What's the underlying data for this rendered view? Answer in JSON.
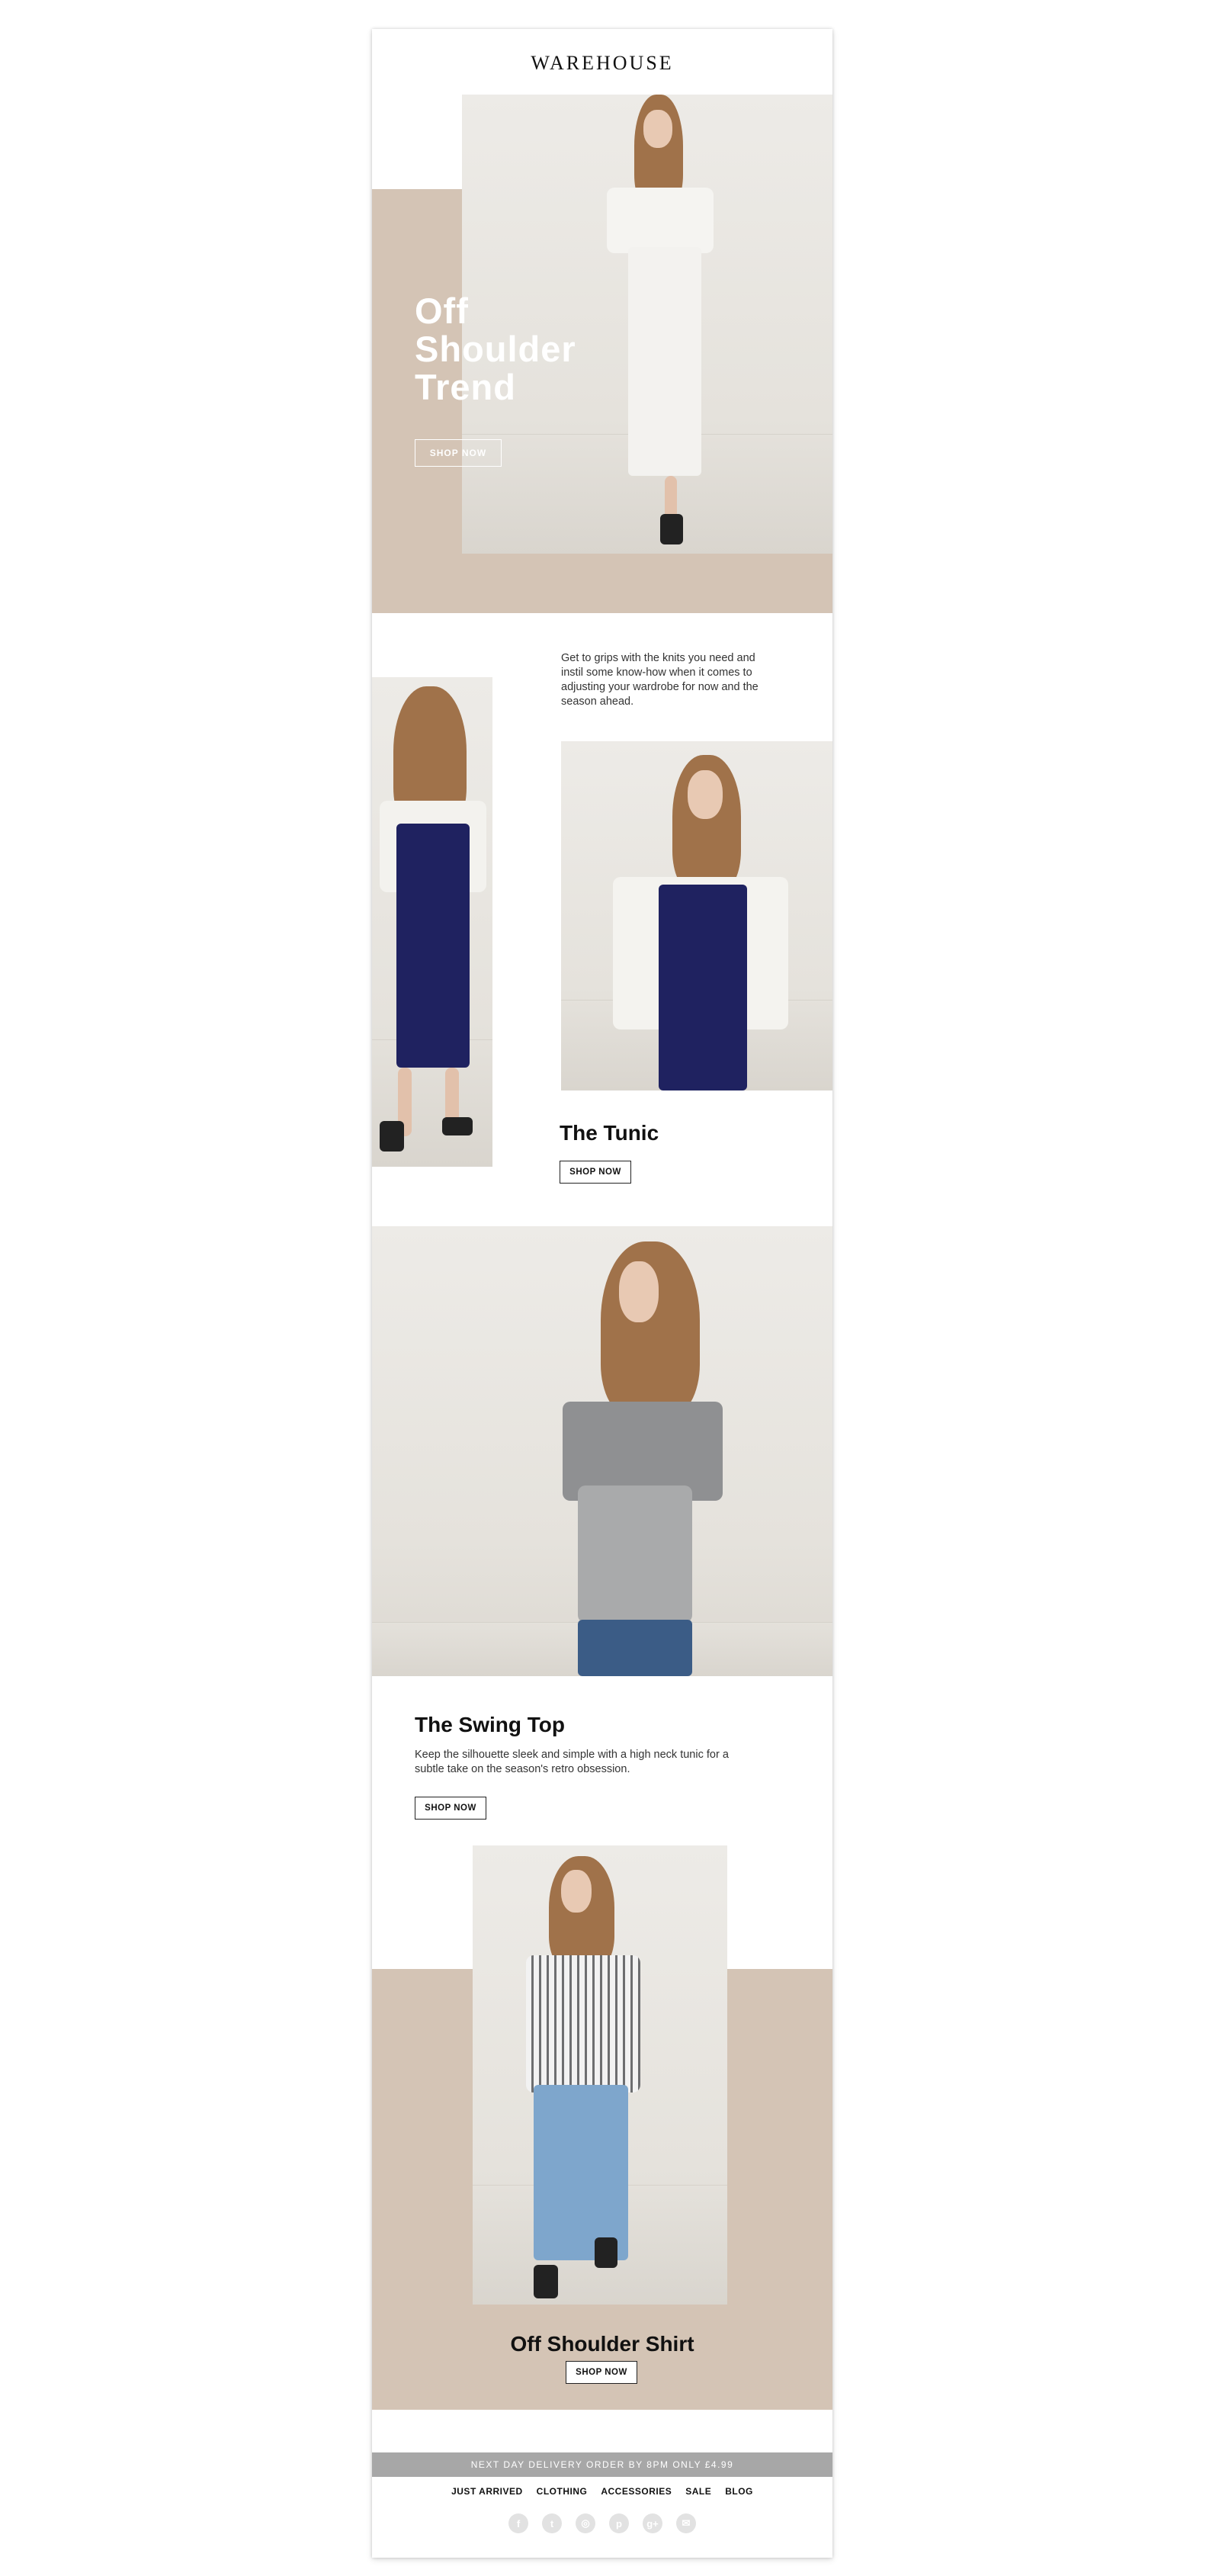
{
  "brand": {
    "logo": "WAREHOUSE"
  },
  "hero": {
    "title_lines": [
      "Off",
      "Shoulder",
      "Trend"
    ],
    "cta": "SHOP NOW",
    "accent_color": "#d4c4b5"
  },
  "tunic": {
    "intro": "Get to grips with the knits you need and instil some know-how when it comes to adjusting your wardrobe for now and the season ahead.",
    "title": "The Tunic",
    "cta": "SHOP NOW"
  },
  "swing_top": {
    "title": "The Swing Top",
    "description": "Keep the silhouette sleek and simple with a high neck tunic for a subtle take on the season's retro obsession.",
    "cta": "SHOP NOW"
  },
  "shirt": {
    "title": "Off Shoulder Shirt",
    "cta": "SHOP NOW"
  },
  "footer": {
    "delivery": "NEXT DAY DELIVERY ORDER BY 8PM ONLY £4.99",
    "nav": [
      "JUST ARRIVED",
      "CLOTHING",
      "ACCESSORIES",
      "SALE",
      "BLOG"
    ],
    "social_icons": [
      "facebook-icon",
      "twitter-icon",
      "instagram-icon",
      "pinterest-icon",
      "google-plus-icon",
      "email-icon"
    ]
  }
}
